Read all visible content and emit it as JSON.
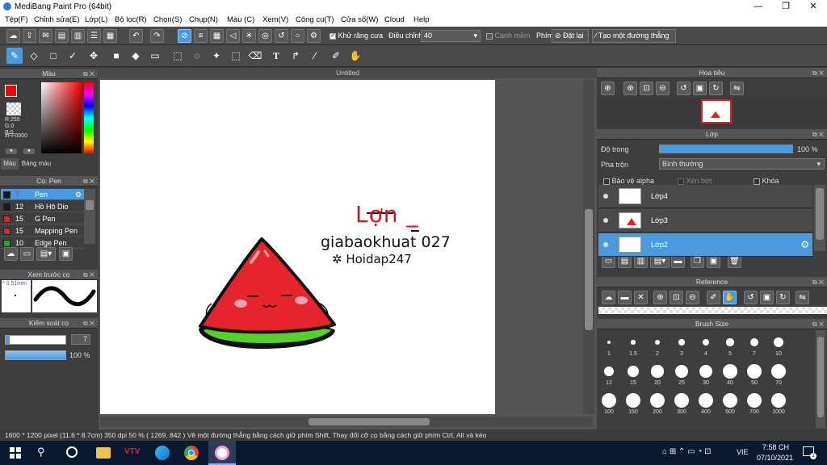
{
  "window": {
    "title": "MediBang Paint Pro (64bit)",
    "min": "—",
    "max": "❐",
    "close": "✕"
  },
  "menu": [
    "Tệp(F)",
    "Chỉnh sửa(E)",
    "Lớp(L)",
    "Bộ lọc(R)",
    "Chọn(S)",
    "Chụp(N)",
    "Màu (C)",
    "Xem(V)",
    "Công cụ(T)",
    "Cửa sổ(W)",
    "Cloud",
    "Help"
  ],
  "toolbar": {
    "antialias_label": "Khử răng cưa",
    "adjust_label": "Điều chỉnh",
    "adjust_value": "40",
    "edge_label": "Cạnh mềm",
    "key_label": "Phím",
    "reset_label": "Đặt lại",
    "create_line_label": "Tạo một đường thẳng"
  },
  "color_panel": {
    "title": "Màu",
    "r": "R:255",
    "g": "G:0",
    "b": "B:0",
    "hex": "#FF0000",
    "tab_color": "Màu",
    "tab_palette": "Bảng màu",
    "primary": "#ff0000",
    "secondary": "#ffffff"
  },
  "brush_panel": {
    "title": "Cọ: Pen",
    "items": [
      {
        "size": "7",
        "name": "Pen",
        "color": "#1a1a1a",
        "selected": true
      },
      {
        "size": "12",
        "name": "Hồ Hô Dio",
        "color": "#1a1a1a",
        "selected": false
      },
      {
        "size": "15",
        "name": "G Pen",
        "color": "#e52222",
        "selected": false
      },
      {
        "size": "15",
        "name": "Mapping Pen",
        "color": "#e52222",
        "selected": false
      },
      {
        "size": "10",
        "name": "Edge Pen",
        "color": "#22aa22",
        "selected": false
      }
    ]
  },
  "preview_panel": {
    "title": "Xem trước cọ",
    "size": "* 0.51mm"
  },
  "brush_control": {
    "title": "Kiểm soát cọ",
    "size_value": "7",
    "opacity_value": "100 %",
    "size_level": 0.07,
    "opacity_level": 1.0
  },
  "canvas": {
    "tab": "Untitled",
    "drawing_text1": "Lợn _",
    "drawing_text2": "giabaokhuat 027",
    "drawing_text3": "✲ Hoidap247"
  },
  "navigator": {
    "title": "Hoa tiêu"
  },
  "layers": {
    "title": "Lớp",
    "opacity_label": "Độ trong",
    "opacity_value": "100 %",
    "opacity_level": 1.0,
    "blend_label": "Pha trộn",
    "blend_value": "Bình thường",
    "protect_alpha": "Bảo vệ alpha",
    "clipping": "Xén bớt",
    "lock": "Khóa",
    "items": [
      {
        "name": "Lớp4",
        "selected": false
      },
      {
        "name": "Lớp3",
        "selected": false
      },
      {
        "name": "Lớp2",
        "selected": true
      }
    ]
  },
  "reference": {
    "title": "Reference"
  },
  "brush_size": {
    "title": "Brush Size",
    "sizes": [
      "1",
      "1.5",
      "2",
      "3",
      "4",
      "5",
      "7",
      "10",
      "12",
      "15",
      "20",
      "25",
      "30",
      "40",
      "50",
      "70",
      "100",
      "150",
      "200",
      "300",
      "400",
      "500",
      "700",
      "1000"
    ]
  },
  "status": {
    "text": "1600 * 1200 pixel   (11.6 * 8.7cm)   350 dpi   50 %   ( 1269, 842 )   Vẽ một đường thẳng bằng cách giữ phím Shift, Thay đổi cỡ cọ bằng cách giữ phím Ctrl, Alt và kéo"
  },
  "taskbar": {
    "lang": "VIE",
    "time": "7:58 CH",
    "date": "07/10/2021",
    "notif": "1"
  }
}
